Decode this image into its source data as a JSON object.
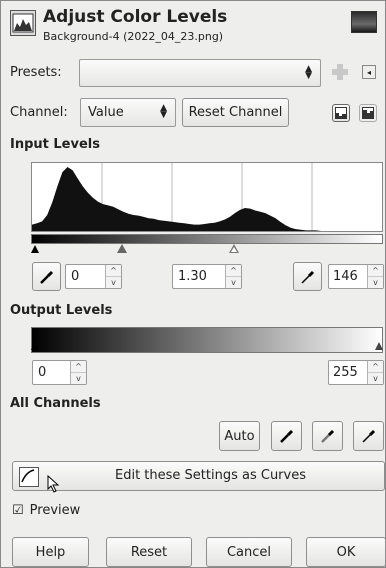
{
  "header": {
    "title": "Adjust Color Levels",
    "subtitle": "Background-4 (2022_04_23.png)"
  },
  "presets": {
    "label": "Presets:",
    "value": ""
  },
  "channel": {
    "label": "Channel:",
    "value": "Value",
    "reset_label": "Reset Channel"
  },
  "input_levels": {
    "heading": "Input Levels",
    "low": "0",
    "gamma": "1.30",
    "high": "146"
  },
  "output_levels": {
    "heading": "Output Levels",
    "low": "0",
    "high": "255"
  },
  "all_channels": {
    "heading": "All Channels",
    "auto_label": "Auto"
  },
  "curves_button": {
    "label": "Edit these Settings as Curves"
  },
  "preview": {
    "label": "Preview",
    "checked": true
  },
  "buttons": {
    "help": "Help",
    "reset": "Reset",
    "cancel": "Cancel",
    "ok": "OK"
  },
  "histogram": {
    "values": [
      0.1,
      0.12,
      0.15,
      0.25,
      0.45,
      0.7,
      0.92,
      1.0,
      0.95,
      0.82,
      0.7,
      0.6,
      0.52,
      0.46,
      0.42,
      0.4,
      0.38,
      0.34,
      0.3,
      0.27,
      0.25,
      0.24,
      0.22,
      0.2,
      0.19,
      0.17,
      0.16,
      0.15,
      0.14,
      0.13,
      0.12,
      0.11,
      0.1,
      0.1,
      0.11,
      0.12,
      0.13,
      0.15,
      0.18,
      0.22,
      0.28,
      0.33,
      0.36,
      0.35,
      0.32,
      0.3,
      0.28,
      0.24,
      0.2,
      0.14,
      0.09,
      0.05,
      0.03,
      0.02,
      0.01,
      0.01,
      0.01,
      0.0,
      0.0,
      0.0,
      0.0,
      0.0,
      0.0,
      0.0,
      0.0,
      0.0,
      0.0,
      0.0,
      0.0,
      0.0
    ]
  }
}
